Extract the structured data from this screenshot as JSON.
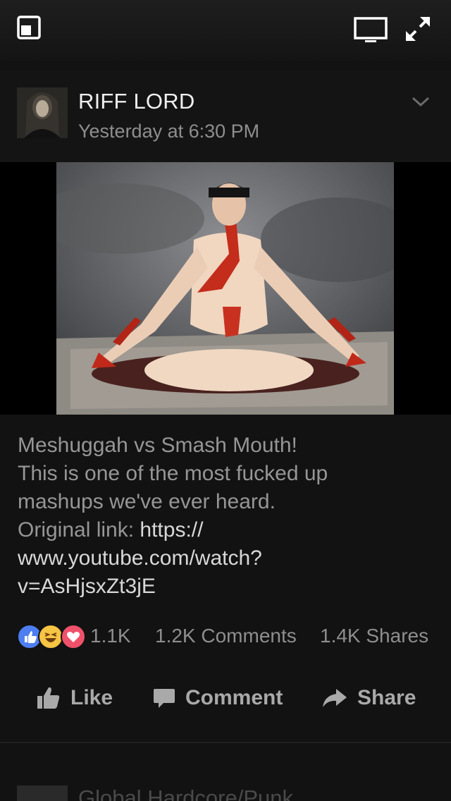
{
  "top_bar": {
    "icons": [
      "picture-in-picture-icon",
      "tv-cast-icon",
      "fullscreen-icon"
    ]
  },
  "post": {
    "author": "RIFF LORD",
    "timestamp": "Yesterday at 6:30 PM",
    "caption_lines": [
      "Meshuggah vs Smash Mouth!",
      "This is one of the most fucked up",
      "mashups we've ever heard."
    ],
    "link_prefix": "Original link: ",
    "link_line1": "https://",
    "link_line2": "www.youtube.com/watch?",
    "link_line3": "v=AsHjsxZt3jE"
  },
  "stats": {
    "reactions": [
      "like",
      "haha",
      "love"
    ],
    "likes": "1.1K",
    "comments": "1.2K Comments",
    "shares": "1.4K Shares"
  },
  "actions": {
    "like": "Like",
    "comment": "Comment",
    "share": "Share"
  },
  "next_post": {
    "author": "Global Hardcore/Punk"
  },
  "colors": {
    "background": "#121212",
    "like_blue": "#4d7ef2",
    "haha_yellow": "#f7c444",
    "love_red": "#f0516a"
  }
}
